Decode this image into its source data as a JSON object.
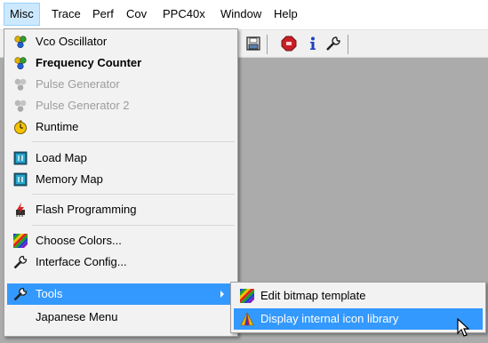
{
  "menubar": {
    "items": [
      {
        "label": "Misc",
        "active": true
      },
      {
        "label": "Trace"
      },
      {
        "label": "Perf"
      },
      {
        "label": "Cov"
      },
      {
        "label": "PPC40x"
      },
      {
        "label": "Window"
      },
      {
        "label": "Help"
      }
    ]
  },
  "toolbar": {
    "icons": [
      "save-disk-icon",
      "stop-hexagon-icon",
      "info-icon",
      "wrench-icon"
    ]
  },
  "menu": {
    "items": [
      {
        "label": "Vco Oscillator",
        "icon": "molecule-icon"
      },
      {
        "label": "Frequency Counter",
        "icon": "molecule-icon",
        "bold": true
      },
      {
        "label": "Pulse Generator",
        "icon": "molecule-icon",
        "disabled": true
      },
      {
        "label": "Pulse Generator 2",
        "icon": "molecule-icon",
        "disabled": true
      },
      {
        "label": "Runtime",
        "icon": "stopwatch-icon"
      },
      {
        "label": "Load Map",
        "icon": "chip-icon"
      },
      {
        "label": "Memory Map",
        "icon": "chip-icon"
      },
      {
        "label": "Flash Programming",
        "icon": "flash-chip-icon"
      },
      {
        "label": "Choose Colors...",
        "icon": "color-palette-icon"
      },
      {
        "label": "Interface Config...",
        "icon": "wrench-icon"
      },
      {
        "label": "Tools",
        "icon": "wrench-icon",
        "highlighted": true,
        "has_submenu": true
      },
      {
        "label": "Japanese Menu"
      }
    ]
  },
  "submenu": {
    "items": [
      {
        "label": "Edit bitmap template",
        "icon": "color-palette-icon"
      },
      {
        "label": "Display internal icon library",
        "icon": "triangle-icon",
        "highlighted": true
      }
    ]
  },
  "colors": {
    "highlight": "#3399ff",
    "menu_bg": "#f2f2f2",
    "disabled_text": "#9c9c9c",
    "workarea": "#ababab"
  }
}
